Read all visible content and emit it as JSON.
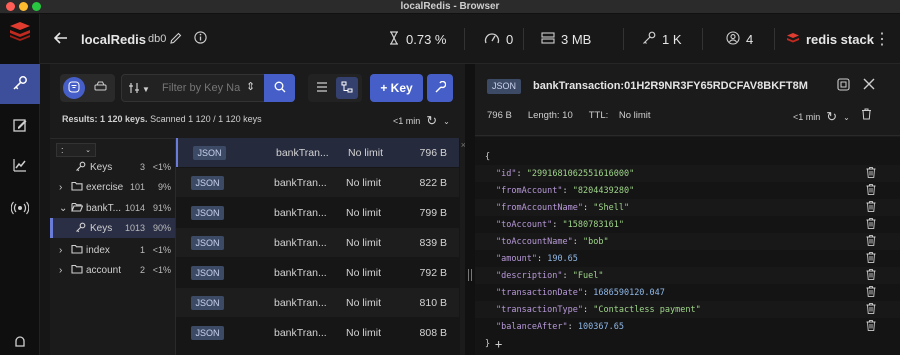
{
  "window": {
    "title": "localRedis - Browser"
  },
  "header": {
    "db_name": "localRedis",
    "db_index": "db0",
    "cpu": "0.73 %",
    "ops": "0",
    "memory": "3 MB",
    "keys": "1 K",
    "clients": "4",
    "brand": "redis stack"
  },
  "browser": {
    "filter_placeholder": "Filter by Key Na",
    "add_key_label": "+ Key",
    "results_label": "Results: 1 120 keys.",
    "scanned_label": "Scanned 1 120 / 1 120 keys",
    "refresh_time": "<1 min",
    "delimiter": ":"
  },
  "tree": [
    {
      "label": "Keys",
      "count": "3",
      "pct": "<1%",
      "type": "key",
      "level": 1
    },
    {
      "label": "exercise",
      "count": "101",
      "pct": "9%",
      "type": "folder",
      "level": 0
    },
    {
      "label": "bankT...",
      "count": "1014",
      "pct": "91%",
      "type": "folder-open",
      "level": 0
    },
    {
      "label": "Keys",
      "count": "1013",
      "pct": "90%",
      "type": "key",
      "level": 1,
      "selected": true
    },
    {
      "label": "index",
      "count": "1",
      "pct": "<1%",
      "type": "folder",
      "level": 0
    },
    {
      "label": "account",
      "count": "2",
      "pct": "<1%",
      "type": "folder",
      "level": 0
    }
  ],
  "keys": [
    {
      "type": "JSON",
      "name": "bankTran...",
      "ttl": "No limit",
      "size": "796 B"
    },
    {
      "type": "JSON",
      "name": "bankTran...",
      "ttl": "No limit",
      "size": "822 B"
    },
    {
      "type": "JSON",
      "name": "bankTran...",
      "ttl": "No limit",
      "size": "799 B"
    },
    {
      "type": "JSON",
      "name": "bankTran...",
      "ttl": "No limit",
      "size": "839 B"
    },
    {
      "type": "JSON",
      "name": "bankTran...",
      "ttl": "No limit",
      "size": "792 B"
    },
    {
      "type": "JSON",
      "name": "bankTran...",
      "ttl": "No limit",
      "size": "810 B"
    },
    {
      "type": "JSON",
      "name": "bankTran...",
      "ttl": "No limit",
      "size": "808 B"
    }
  ],
  "detail": {
    "type": "JSON",
    "key_name": "bankTransaction:01H2R9NR3FY65RDCFAV8BKFT8M",
    "size": "796 B",
    "length": "Length: 10",
    "ttl_label": "TTL:",
    "ttl_value": "No limit",
    "refresh_time": "<1 min",
    "open_brace": "{",
    "close_brace": "}",
    "add_symbol": "+",
    "fields": [
      {
        "key": "\"id\"",
        "value": "\"2991681062551616000\"",
        "kind": "string"
      },
      {
        "key": "\"fromAccount\"",
        "value": "\"8204439280\"",
        "kind": "string"
      },
      {
        "key": "\"fromAccountName\"",
        "value": "\"Shell\"",
        "kind": "string"
      },
      {
        "key": "\"toAccount\"",
        "value": "\"1580783161\"",
        "kind": "string"
      },
      {
        "key": "\"toAccountName\"",
        "value": "\"bob\"",
        "kind": "string"
      },
      {
        "key": "\"amount\"",
        "value": "190.65",
        "kind": "number"
      },
      {
        "key": "\"description\"",
        "value": "\"Fuel\"",
        "kind": "string"
      },
      {
        "key": "\"transactionDate\"",
        "value": "1686590120.047",
        "kind": "number"
      },
      {
        "key": "\"transactionType\"",
        "value": "\"Contactless payment\"",
        "kind": "string"
      },
      {
        "key": "\"balanceAfter\"",
        "value": "100367.65",
        "kind": "number"
      }
    ]
  },
  "colors": {
    "accent": "#465fc8",
    "sidebar_active": "#3d4f9a",
    "json_key": "#b89ad9",
    "json_string": "#9fd58a",
    "json_number": "#8fb7e6"
  }
}
